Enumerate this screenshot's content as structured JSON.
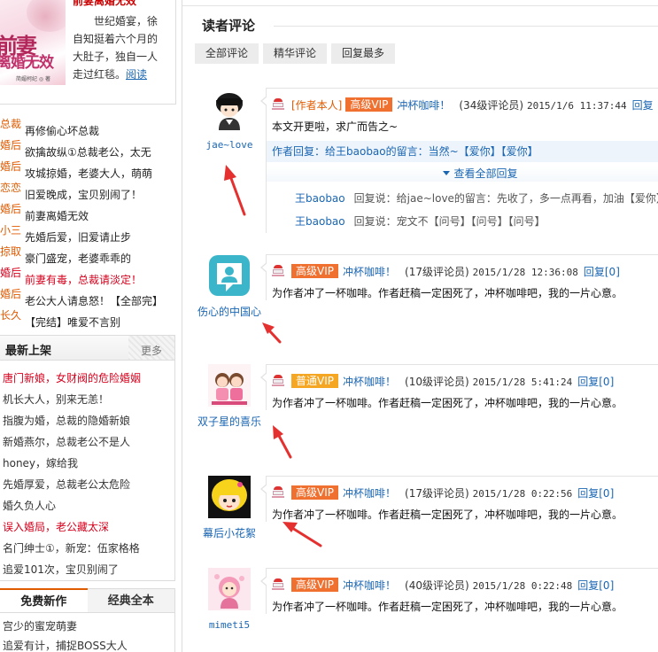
{
  "sidebar": {
    "book": {
      "cover_line1": "前妻",
      "cover_line2": "离婚无效",
      "cover_foot": "简媚柯纪 ◎ 著",
      "title_top": "前妻离婚无效",
      "desc": "世纪婚宴，徐自知挺着六个月的大肚子，独自一人走过红毯。",
      "read_link": "阅读"
    },
    "rank_list": [
      {
        "category": "总裁",
        "title": "再修偷心坏总裁",
        "red": false
      },
      {
        "category": "婚后",
        "title": "欲擒故纵①总裁老公，太无",
        "red": false
      },
      {
        "category": "婚后",
        "title": "攻城掠婚，老婆大人，萌萌",
        "red": false
      },
      {
        "category": "恋恋",
        "title": "旧爱晚成，宝贝别闹了！",
        "red": false
      },
      {
        "category": "婚后",
        "title": "前妻离婚无效",
        "red": false
      },
      {
        "category": "小三",
        "title": "先婚后爱，旧爱请止步",
        "red": false
      },
      {
        "category": "掠取",
        "title": "豪门盛宠，老婆乖乖的",
        "red": false
      },
      {
        "category": "婚后",
        "title": "前妻有毒，总裁请淡定！",
        "red": true
      },
      {
        "category": "婚后",
        "title": "老公大人请息怒！【全部完】",
        "red": false
      },
      {
        "category": "长久",
        "title": "【完结】唯爱不言别",
        "red": false
      }
    ],
    "new_releases": {
      "title": "最新上架",
      "more": "更多",
      "items": [
        {
          "text": "唐门新娘，女财阀的危险婚姻",
          "red": false
        },
        {
          "text": "机长大人，别来无恙！",
          "red": false
        },
        {
          "text": "指腹为婚，总裁的隐婚新娘",
          "red": false
        },
        {
          "text": "新婚燕尔，总裁老公不是人",
          "red": false
        },
        {
          "text": "honey，嫁给我",
          "red": false
        },
        {
          "text": "先婚厚爱，总裁老公太危险",
          "red": false
        },
        {
          "text": "婚久负人心",
          "red": false
        },
        {
          "text": "误入婚局，老公藏太深",
          "red": true
        },
        {
          "text": "名门绅士①，新宠：伍家格格",
          "red": false
        },
        {
          "text": "追爱101次，宝贝别闹了",
          "red": false
        }
      ]
    },
    "free_tabs": {
      "tab1": "免费新作",
      "tab2": "经典全本",
      "items": [
        "宫少的蜜宠萌妻",
        "追爱有计，捕捉BOSS大人"
      ]
    }
  },
  "comments_panel": {
    "title": "读者评论",
    "filters": [
      "全部评论",
      "精华评论",
      "回复最多"
    ],
    "comments": [
      {
        "username": "jae~love",
        "author_tag": "[作者本人]",
        "vip": "高级VIP",
        "vip_type": "high",
        "gift": "冲杯咖啡！",
        "level": "(34级评论员)",
        "time": "2015/1/6 11:37:44",
        "reply": "回复",
        "body": "本文开更啦，求广而告之~",
        "author_reply": "作者回复：给王baobao的留言：当然~【爱你】【爱你】",
        "view_all": "查看全部回复",
        "sub_replies": [
          {
            "user": "王baobao",
            "text": "回复说：给jae~love的留言：先收了，多一点再看，加油【爱你】"
          },
          {
            "user": "王baobao",
            "text": "回复说：宠文不【问号】【问号】【问号】"
          }
        ]
      },
      {
        "username": "伤心的中国心",
        "author_tag": "",
        "vip": "高级VIP",
        "vip_type": "high",
        "gift": "冲杯咖啡！",
        "level": "(17级评论员)",
        "time": "2015/1/28 12:36:08",
        "reply": "回复[0]",
        "body": "为作者冲了一杯咖啡。作者赶稿一定困死了，冲杯咖啡吧，我的一片心意。"
      },
      {
        "username": "双子星的喜乐",
        "author_tag": "",
        "vip": "普通VIP",
        "vip_type": "normal",
        "gift": "冲杯咖啡！",
        "level": "(10级评论员)",
        "time": "2015/1/28 5:41:24",
        "reply": "回复[0]",
        "body": "为作者冲了一杯咖啡。作者赶稿一定困死了，冲杯咖啡吧，我的一片心意。"
      },
      {
        "username": "幕后小花絮",
        "author_tag": "",
        "vip": "高级VIP",
        "vip_type": "high",
        "gift": "冲杯咖啡！",
        "level": "(17级评论员)",
        "time": "2015/1/28 0:22:56",
        "reply": "回复[0]",
        "body": "为作者冲了一杯咖啡。作者赶稿一定困死了，冲杯咖啡吧，我的一片心意。"
      },
      {
        "username": "mimeti5",
        "author_tag": "",
        "vip": "高级VIP",
        "vip_type": "high",
        "gift": "冲杯咖啡！",
        "level": "(40级评论员)",
        "time": "2015/1/28 0:22:48",
        "reply": "回复[0]",
        "body": "为作者冲了一杯咖啡。作者赶稿一定困死了，冲杯咖啡吧，我的一片心意。"
      }
    ]
  },
  "colors": {
    "link": "#1a66b3",
    "vip_high": "#f07030",
    "vip_normal": "#f5a623",
    "annotation_arrow": "#e53030"
  }
}
